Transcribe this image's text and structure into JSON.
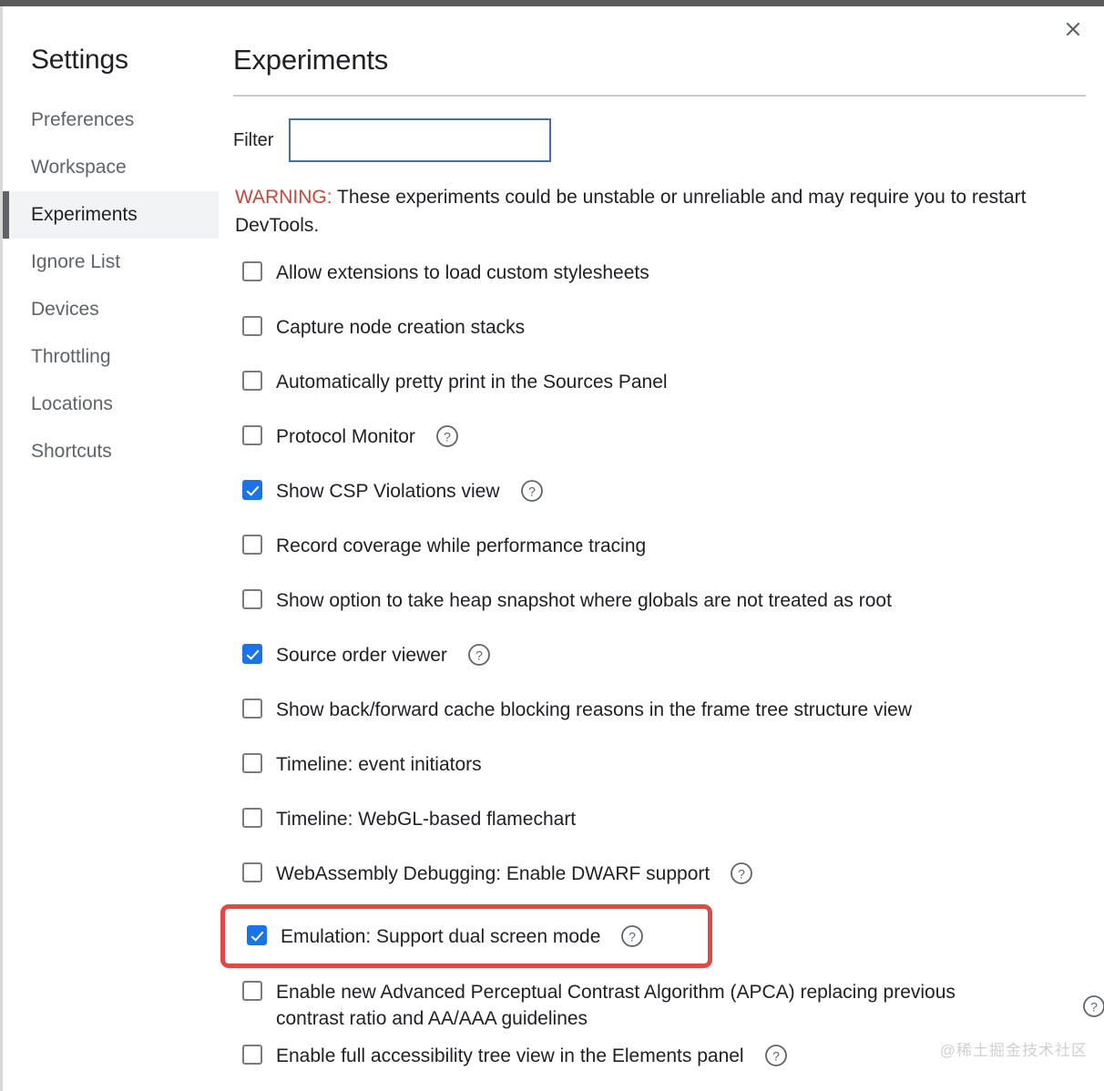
{
  "window": {
    "close_icon": "close-icon"
  },
  "sidebar": {
    "title": "Settings",
    "items": [
      {
        "label": "Preferences",
        "selected": false
      },
      {
        "label": "Workspace",
        "selected": false
      },
      {
        "label": "Experiments",
        "selected": true
      },
      {
        "label": "Ignore List",
        "selected": false
      },
      {
        "label": "Devices",
        "selected": false
      },
      {
        "label": "Throttling",
        "selected": false
      },
      {
        "label": "Locations",
        "selected": false
      },
      {
        "label": "Shortcuts",
        "selected": false
      }
    ]
  },
  "main": {
    "title": "Experiments",
    "filter": {
      "label": "Filter",
      "value": "",
      "placeholder": ""
    },
    "warning": {
      "tag": "WARNING:",
      "text": " These experiments could be unstable or unreliable and may require you to restart DevTools."
    },
    "experiments": [
      {
        "label": "Allow extensions to load custom stylesheets",
        "checked": false,
        "help": false,
        "highlighted": false
      },
      {
        "label": "Capture node creation stacks",
        "checked": false,
        "help": false,
        "highlighted": false
      },
      {
        "label": "Automatically pretty print in the Sources Panel",
        "checked": false,
        "help": false,
        "highlighted": false
      },
      {
        "label": "Protocol Monitor",
        "checked": false,
        "help": true,
        "highlighted": false
      },
      {
        "label": "Show CSP Violations view",
        "checked": true,
        "help": true,
        "highlighted": false
      },
      {
        "label": "Record coverage while performance tracing",
        "checked": false,
        "help": false,
        "highlighted": false
      },
      {
        "label": "Show option to take heap snapshot where globals are not treated as root",
        "checked": false,
        "help": false,
        "highlighted": false
      },
      {
        "label": "Source order viewer",
        "checked": true,
        "help": true,
        "highlighted": false
      },
      {
        "label": "Show back/forward cache blocking reasons in the frame tree structure view",
        "checked": false,
        "help": false,
        "highlighted": false
      },
      {
        "label": "Timeline: event initiators",
        "checked": false,
        "help": false,
        "highlighted": false
      },
      {
        "label": "Timeline: WebGL-based flamechart",
        "checked": false,
        "help": false,
        "highlighted": false
      },
      {
        "label": "WebAssembly Debugging: Enable DWARF support",
        "checked": false,
        "help": true,
        "highlighted": false
      },
      {
        "label": "Emulation: Support dual screen mode",
        "checked": true,
        "help": true,
        "highlighted": true
      },
      {
        "label": "Enable new Advanced Perceptual Contrast Algorithm (APCA) replacing previous contrast ratio and AA/AAA guidelines",
        "checked": false,
        "help": true,
        "help_far": true,
        "wrap": true,
        "highlighted": false
      },
      {
        "label": "Enable full accessibility tree view in the Elements panel",
        "checked": false,
        "help": true,
        "highlighted": false
      }
    ]
  },
  "watermark": "@稀土掘金技术社区",
  "colors": {
    "accent_checkbox": "#1a73e8",
    "warning_text": "#c5483c",
    "highlight_box": "#e04a45",
    "selected_sidebar_bg": "#f1f3f4",
    "sidebar_accent": "#5f6368",
    "filter_border": "#4a7099",
    "divider": "#cccccc"
  }
}
